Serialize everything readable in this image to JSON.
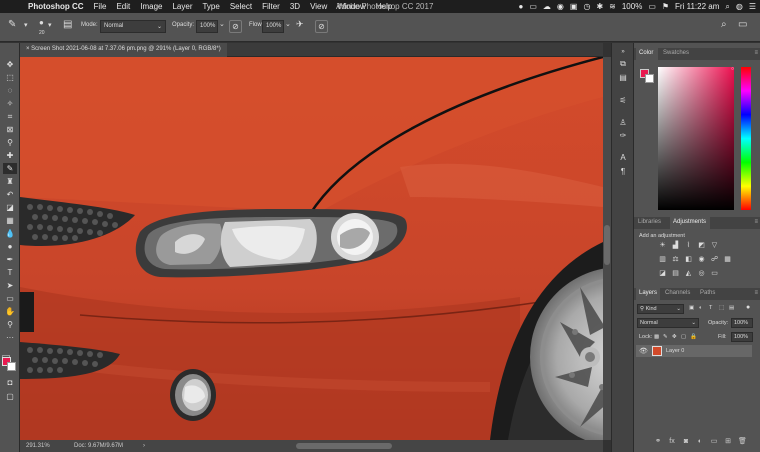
{
  "menubar": {
    "app_name": "Photoshop CC",
    "items": [
      "File",
      "Edit",
      "Image",
      "Layer",
      "Type",
      "Select",
      "Filter",
      "3D",
      "View",
      "Window",
      "Help"
    ],
    "window_title": "Adobe Photoshop CC 2017",
    "battery": "100%",
    "clock": "Fri 11:22 am"
  },
  "options": {
    "brush_size": "20",
    "mode_label": "Mode:",
    "mode_value": "Normal",
    "opacity_label": "Opacity:",
    "opacity_value": "100%",
    "flow_label": "Flow:",
    "flow_value": "100%"
  },
  "document": {
    "tab_title": "Screen Shot 2021-06-08 at 7.37.06 pm.png @ 291% (Layer 0, RGB/8*)",
    "zoom": "291.31%",
    "doc_size": "Doc: 9.67M/9.67M"
  },
  "panels": {
    "color_tab": "Color",
    "swatches_tab": "Swatches",
    "libraries_tab": "Libraries",
    "adjustments_tab": "Adjustments",
    "add_adjustment": "Add an adjustment",
    "layers_tab": "Layers",
    "channels_tab": "Channels",
    "paths_tab": "Paths",
    "kind_filter": "Kind",
    "blend_mode": "Normal",
    "opacity_label": "Opacity:",
    "opacity_value": "100%",
    "lock_label": "Lock:",
    "fill_label": "Fill:",
    "fill_value": "100%",
    "layer_name": "Layer 0"
  },
  "colors": {
    "foreground": "#e8194f",
    "background": "#ffffff",
    "car_body": "#d24a2a"
  }
}
